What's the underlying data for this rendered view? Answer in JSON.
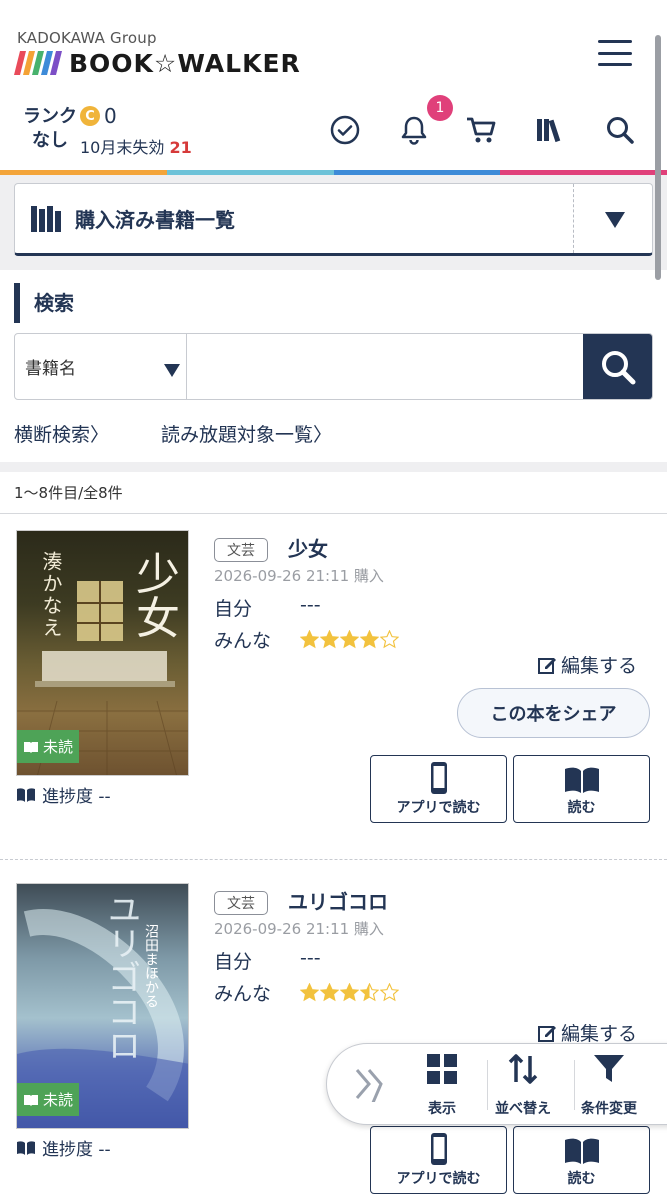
{
  "header": {
    "group_name": "KADOKAWA Group",
    "logo_text": "BOOK☆WALKER",
    "rank_line1": "ランク",
    "rank_line2": "なし",
    "coin_letter": "C",
    "coin_amount": "0",
    "expire_label": "10月末失効",
    "expire_value": "21",
    "notification_count": "1",
    "icons": [
      "check-circle-icon",
      "bell-icon",
      "cart-icon",
      "library-icon",
      "search-icon",
      "menu-icon"
    ],
    "stripe_colors": [
      "#e94b5a",
      "#f4a236",
      "#48b26d",
      "#3d8bd8",
      "#7c4fc6"
    ],
    "color_bar": [
      "#f3a43a",
      "#6dc2d8",
      "#3d8bd8",
      "#e0407a"
    ]
  },
  "dropdown": {
    "label": "購入済み書籍一覧"
  },
  "search": {
    "title": "検索",
    "select_value": "書籍名",
    "input_value": "",
    "input_placeholder": ""
  },
  "links": {
    "cross_search": "横断検索〉",
    "unlimited_list": "読み放題対象一覧〉"
  },
  "count_text": "1〜8件目/全8件",
  "books": [
    {
      "genre": "文芸",
      "title": "少女",
      "date": "2026-09-26 21:11 購入",
      "self_label": "自分",
      "self_value": "---",
      "everyone_label": "みんな",
      "everyone_rating": 4,
      "cover_author": "湊かなえ",
      "cover_title": "少女",
      "unread": "未読",
      "progress": "進捗度 --",
      "edit": "編集する",
      "share": "この本をシェア",
      "app_read": "アプリで読む",
      "read": "読む"
    },
    {
      "genre": "文芸",
      "title": "ユリゴコロ",
      "date": "2026-09-26 21:11 購入",
      "self_label": "自分",
      "self_value": "---",
      "everyone_label": "みんな",
      "everyone_rating": 3.5,
      "cover_author": "沼田まほかる",
      "cover_title": "ユリゴコロ",
      "unread": "未読",
      "progress": "進捗度 --",
      "edit": "編集する",
      "app_read": "アプリで読む",
      "read": "読む"
    }
  ],
  "toolbar": {
    "display": "表示",
    "sort": "並べ替え",
    "filter": "条件変更"
  },
  "colors": {
    "navy": "#233554",
    "badge": "#e0407a",
    "unread": "#4ea357",
    "star": "#f2c23e"
  }
}
